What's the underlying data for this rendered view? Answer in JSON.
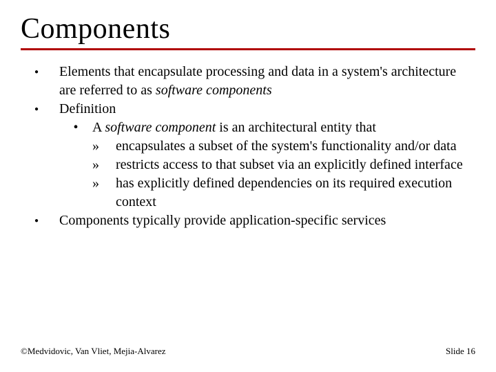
{
  "title": "Components",
  "bullets": {
    "b1_pre": "Elements that encapsulate processing and data in a system's architecture are referred to as ",
    "b1_em": "software components",
    "b2": "Definition",
    "b2_1_pre": "A ",
    "b2_1_em": "software component",
    "b2_1_post": " is an architectural entity that",
    "b2_1_a": "encapsulates a subset of the system's functionality and/or data",
    "b2_1_b": "restricts access to that subset via an explicitly defined interface",
    "b2_1_c": "has explicitly defined dependencies on its required execution context",
    "b3": "Components typically provide application-specific services"
  },
  "footer": {
    "left": "©Medvidovic, Van Vliet, Mejia-Alvarez",
    "right": "Slide 16"
  }
}
